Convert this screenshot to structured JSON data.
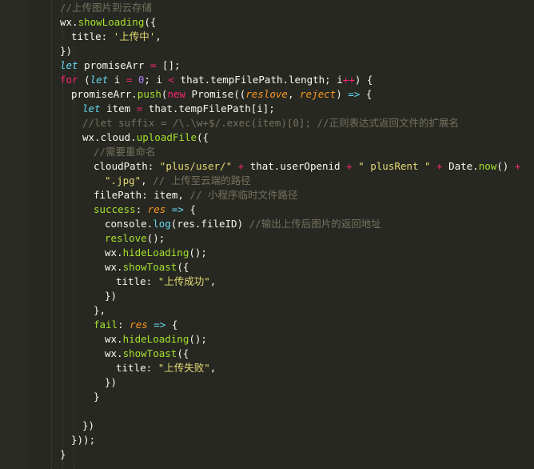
{
  "editor": {
    "theme_colors": {
      "background": "#272822",
      "comment": "#75715e",
      "string": "#e6db74",
      "keyword": "#f92672",
      "storage": "#66d9ef",
      "function": "#a6e22e",
      "parameter": "#fd971f",
      "number": "#ae81ff"
    },
    "lines": [
      {
        "indent": 0,
        "segs": [
          {
            "t": "//上传图片到云存储",
            "c": "comment"
          }
        ]
      },
      {
        "indent": 0,
        "segs": [
          {
            "t": "wx.",
            "c": "text"
          },
          {
            "t": "showLoading",
            "c": "func"
          },
          {
            "t": "({",
            "c": "text"
          }
        ]
      },
      {
        "indent": 1,
        "segs": [
          {
            "t": "title: ",
            "c": "text"
          },
          {
            "t": "'上传中'",
            "c": "string"
          },
          {
            "t": ",",
            "c": "text"
          }
        ]
      },
      {
        "indent": 0,
        "segs": [
          {
            "t": "})",
            "c": "text"
          }
        ]
      },
      {
        "indent": 0,
        "segs": [
          {
            "t": "let",
            "c": "storage"
          },
          {
            "t": " promiseArr ",
            "c": "text"
          },
          {
            "t": "=",
            "c": "keyword"
          },
          {
            "t": " [];",
            "c": "text"
          }
        ]
      },
      {
        "indent": 0,
        "segs": [
          {
            "t": "for",
            "c": "keyword"
          },
          {
            "t": " (",
            "c": "text"
          },
          {
            "t": "let",
            "c": "storage"
          },
          {
            "t": " i ",
            "c": "text"
          },
          {
            "t": "=",
            "c": "keyword"
          },
          {
            "t": " ",
            "c": "text"
          },
          {
            "t": "0",
            "c": "number"
          },
          {
            "t": "; i ",
            "c": "text"
          },
          {
            "t": "<",
            "c": "keyword"
          },
          {
            "t": " that.tempFilePath.length; i",
            "c": "text"
          },
          {
            "t": "++",
            "c": "keyword"
          },
          {
            "t": ") {",
            "c": "text"
          }
        ]
      },
      {
        "indent": 1,
        "segs": [
          {
            "t": "promiseArr.",
            "c": "text"
          },
          {
            "t": "push",
            "c": "func"
          },
          {
            "t": "(",
            "c": "text"
          },
          {
            "t": "new",
            "c": "keyword"
          },
          {
            "t": " Promise((",
            "c": "text"
          },
          {
            "t": "reslove",
            "c": "param"
          },
          {
            "t": ", ",
            "c": "text"
          },
          {
            "t": "reject",
            "c": "param"
          },
          {
            "t": ") ",
            "c": "text"
          },
          {
            "t": "=>",
            "c": "storage"
          },
          {
            "t": " {",
            "c": "text"
          }
        ]
      },
      {
        "indent": 2,
        "segs": [
          {
            "t": "let",
            "c": "storage"
          },
          {
            "t": " item ",
            "c": "text"
          },
          {
            "t": "=",
            "c": "keyword"
          },
          {
            "t": " that.tempFilePath[i];",
            "c": "text"
          }
        ]
      },
      {
        "indent": 2,
        "segs": [
          {
            "t": "//let suffix = /\\.\\w+$/.exec(item)[0]; //正则表达式返回文件的扩展名",
            "c": "comment"
          }
        ]
      },
      {
        "indent": 2,
        "segs": [
          {
            "t": "wx.cloud.",
            "c": "text"
          },
          {
            "t": "uploadFile",
            "c": "func"
          },
          {
            "t": "({",
            "c": "text"
          }
        ]
      },
      {
        "indent": 3,
        "segs": [
          {
            "t": "//需要重命名",
            "c": "comment"
          }
        ]
      },
      {
        "indent": 3,
        "segs": [
          {
            "t": "cloudPath: ",
            "c": "text"
          },
          {
            "t": "\"plus/user/\"",
            "c": "string"
          },
          {
            "t": " ",
            "c": "text"
          },
          {
            "t": "+",
            "c": "keyword"
          },
          {
            "t": " that.userOpenid ",
            "c": "text"
          },
          {
            "t": "+",
            "c": "keyword"
          },
          {
            "t": " ",
            "c": "text"
          },
          {
            "t": "\" plusRent \"",
            "c": "string"
          },
          {
            "t": " ",
            "c": "text"
          },
          {
            "t": "+",
            "c": "keyword"
          },
          {
            "t": " Date.",
            "c": "text"
          },
          {
            "t": "now",
            "c": "func"
          },
          {
            "t": "() ",
            "c": "text"
          },
          {
            "t": "+",
            "c": "keyword"
          }
        ]
      },
      {
        "indent": 4,
        "segs": [
          {
            "t": "\".jpg\"",
            "c": "string"
          },
          {
            "t": ", ",
            "c": "text"
          },
          {
            "t": "// 上传至云端的路径",
            "c": "comment"
          }
        ]
      },
      {
        "indent": 3,
        "segs": [
          {
            "t": "filePath: item, ",
            "c": "text"
          },
          {
            "t": "// 小程序临时文件路径",
            "c": "comment"
          }
        ]
      },
      {
        "indent": 3,
        "segs": [
          {
            "t": "success",
            "c": "func"
          },
          {
            "t": ": ",
            "c": "text"
          },
          {
            "t": "res",
            "c": "param"
          },
          {
            "t": " ",
            "c": "text"
          },
          {
            "t": "=>",
            "c": "storage"
          },
          {
            "t": " {",
            "c": "text"
          }
        ]
      },
      {
        "indent": 4,
        "segs": [
          {
            "t": "console",
            "c": "text"
          },
          {
            "t": ".",
            "c": "text"
          },
          {
            "t": "log",
            "c": "support"
          },
          {
            "t": "(res.fileID) ",
            "c": "text"
          },
          {
            "t": "//输出上传后图片的返回地址",
            "c": "comment"
          }
        ]
      },
      {
        "indent": 4,
        "segs": [
          {
            "t": "reslove",
            "c": "func"
          },
          {
            "t": "();",
            "c": "text"
          }
        ]
      },
      {
        "indent": 4,
        "segs": [
          {
            "t": "wx.",
            "c": "text"
          },
          {
            "t": "hideLoading",
            "c": "func"
          },
          {
            "t": "();",
            "c": "text"
          }
        ]
      },
      {
        "indent": 4,
        "segs": [
          {
            "t": "wx.",
            "c": "text"
          },
          {
            "t": "showToast",
            "c": "func"
          },
          {
            "t": "({",
            "c": "text"
          }
        ]
      },
      {
        "indent": 5,
        "segs": [
          {
            "t": "title: ",
            "c": "text"
          },
          {
            "t": "\"上传成功\"",
            "c": "string"
          },
          {
            "t": ",",
            "c": "text"
          }
        ]
      },
      {
        "indent": 4,
        "segs": [
          {
            "t": "})",
            "c": "text"
          }
        ]
      },
      {
        "indent": 3,
        "segs": [
          {
            "t": "},",
            "c": "text"
          }
        ]
      },
      {
        "indent": 3,
        "segs": [
          {
            "t": "fail",
            "c": "func"
          },
          {
            "t": ": ",
            "c": "text"
          },
          {
            "t": "res",
            "c": "param"
          },
          {
            "t": " ",
            "c": "text"
          },
          {
            "t": "=>",
            "c": "storage"
          },
          {
            "t": " {",
            "c": "text"
          }
        ]
      },
      {
        "indent": 4,
        "segs": [
          {
            "t": "wx.",
            "c": "text"
          },
          {
            "t": "hideLoading",
            "c": "func"
          },
          {
            "t": "();",
            "c": "text"
          }
        ]
      },
      {
        "indent": 4,
        "segs": [
          {
            "t": "wx.",
            "c": "text"
          },
          {
            "t": "showToast",
            "c": "func"
          },
          {
            "t": "({",
            "c": "text"
          }
        ]
      },
      {
        "indent": 5,
        "segs": [
          {
            "t": "title: ",
            "c": "text"
          },
          {
            "t": "\"上传失败\"",
            "c": "string"
          },
          {
            "t": ",",
            "c": "text"
          }
        ]
      },
      {
        "indent": 4,
        "segs": [
          {
            "t": "})",
            "c": "text"
          }
        ]
      },
      {
        "indent": 3,
        "segs": [
          {
            "t": "}",
            "c": "text"
          }
        ]
      },
      {
        "indent": 0,
        "segs": []
      },
      {
        "indent": 2,
        "segs": [
          {
            "t": "})",
            "c": "text"
          }
        ]
      },
      {
        "indent": 1,
        "segs": [
          {
            "t": "}));",
            "c": "text"
          }
        ]
      },
      {
        "indent": 0,
        "segs": [
          {
            "t": "}",
            "c": "text"
          }
        ]
      }
    ]
  }
}
